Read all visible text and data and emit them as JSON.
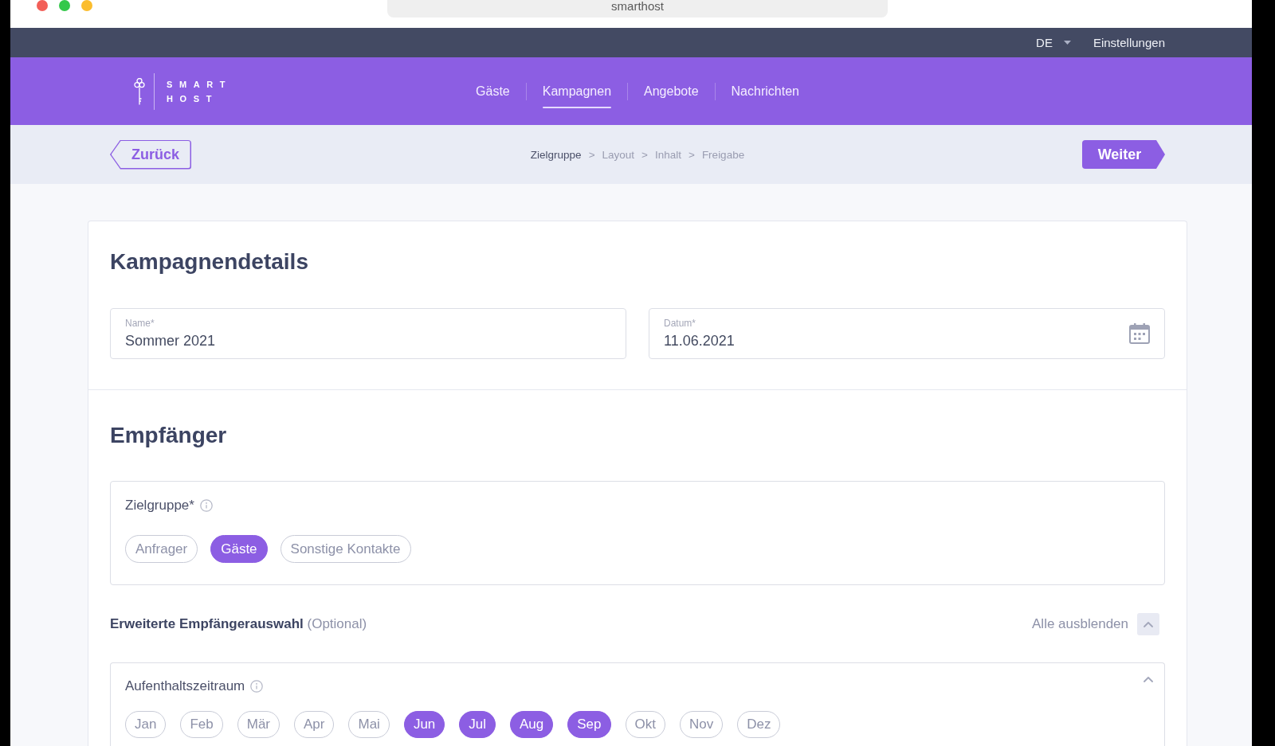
{
  "browser": {
    "address": "smarthost"
  },
  "top_bar": {
    "language": "DE",
    "settings": "Einstellungen"
  },
  "header": {
    "logo": [
      "SMART",
      "HOST"
    ],
    "nav": [
      {
        "label": "Gäste",
        "selected": false
      },
      {
        "label": "Kampagnen",
        "selected": true
      },
      {
        "label": "Angebote",
        "selected": false
      },
      {
        "label": "Nachrichten",
        "selected": false
      }
    ]
  },
  "wizard": {
    "back": "Zurück",
    "steps": [
      {
        "label": "Zielgruppe",
        "selected": true
      },
      {
        "separator": ">",
        "label": "Layout",
        "selected": false
      },
      {
        "separator": ">",
        "label": "Inhalt",
        "selected": false
      },
      {
        "separator": ">",
        "label": "Freigabe",
        "selected": false
      }
    ],
    "next": "Weiter"
  },
  "campaign_details": {
    "title": "Kampagnendetails",
    "fields": [
      {
        "kind": "text",
        "label": "Name*",
        "value": "Sommer 2021"
      },
      {
        "kind": "date",
        "label": "Datum*",
        "value": "11.06.2021"
      }
    ]
  },
  "recipients": {
    "title": "Empfänger",
    "target_group": {
      "label": "Zielgruppe*",
      "options": [
        {
          "label": "Anfrager",
          "selected": false
        },
        {
          "label": "Gäste",
          "selected": true
        },
        {
          "label": "Sonstige Kontakte",
          "selected": false
        }
      ]
    },
    "advanced": {
      "title": "**Erweiterte Empfängerauswahl** (Optional)",
      "toggle": "Alle ausblenden",
      "expanded": true
    },
    "stay_period": {
      "label": "Aufenthaltszeitraum",
      "expanded": true,
      "months": [
        {
          "label": "Jan",
          "selected": false
        },
        {
          "label": "Feb",
          "selected": false
        },
        {
          "label": "Mär",
          "selected": false
        },
        {
          "label": "Apr",
          "selected": false
        },
        {
          "label": "Mai",
          "selected": false
        },
        {
          "label": "Jun",
          "selected": true
        },
        {
          "label": "Jul",
          "selected": true
        },
        {
          "label": "Aug",
          "selected": true
        },
        {
          "label": "Sep",
          "selected": true
        },
        {
          "label": "Okt",
          "selected": false
        },
        {
          "label": "Nov",
          "selected": false
        },
        {
          "label": "Dez",
          "selected": false
        }
      ]
    }
  }
}
